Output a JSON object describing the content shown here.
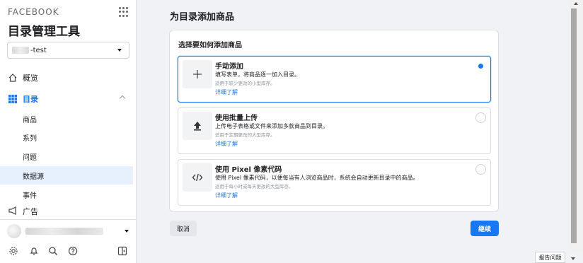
{
  "sidebar": {
    "brand": "FACEBOOK",
    "app_title": "目录管理工具",
    "account_suffix": "-test",
    "nav": {
      "overview": "概览",
      "catalog": "目录",
      "ads_partial": "广告"
    },
    "sub_items": [
      "商品",
      "系列",
      "问题",
      "数据源",
      "事件"
    ],
    "selected_sub_item": "数据源"
  },
  "main": {
    "heading": "为目录添加商品",
    "card_title": "选择要如何添加商品",
    "options": [
      {
        "icon": "plus-icon",
        "title": "手动添加",
        "desc": "填写表单，将商品逐一加入目录。",
        "hint": "适用于较少更改的小型库存。",
        "link": "详细了解",
        "selected": true
      },
      {
        "icon": "upload-icon",
        "title": "使用批量上传",
        "desc": "上传电子表格或文件来添加多款商品到目录。",
        "hint": "适用于定期更改的大型库存。",
        "link": "详细了解",
        "selected": false
      },
      {
        "icon": "code-icon",
        "title": "使用 Pixel 像素代码",
        "desc": "使用 Pixel 像素代码，以便每当有人浏览商品时，系统会自动更新目录中的商品。",
        "hint": "适用于每小时或每天更改的大型库存。",
        "link": "详细了解",
        "selected": false
      }
    ],
    "cancel_label": "取消",
    "continue_label": "继续"
  },
  "report_label": "报告问题",
  "colors": {
    "accent": "#1877f2",
    "selected_bg": "#e7f0fd",
    "page_bg": "#f0f2f5"
  }
}
